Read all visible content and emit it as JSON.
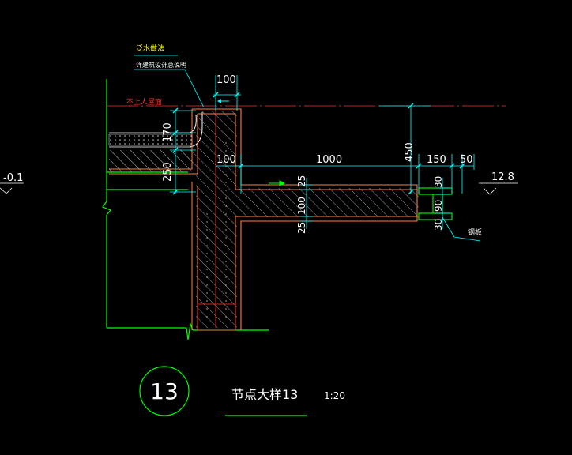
{
  "colors": {
    "background": "#000000",
    "outline": "#ff8040",
    "hatch": "#b0b0b0",
    "structure": "#00ff00",
    "dimension": "#00ffff",
    "dim_text": "#ffffff",
    "level_line": "#ff3030",
    "note_text": "#ffff00",
    "arrow": "#00ff00"
  },
  "notes": {
    "waterproof_method": "泛水做法",
    "see_spec": "详建筑设计总说明",
    "no_roof_access": "不上人屋面",
    "steel_plate": "钢板"
  },
  "levels": {
    "left": "-0.1",
    "right": "12.8"
  },
  "dimensions": {
    "top_width": "100",
    "curb_height": "170",
    "wall_drop": "250",
    "left_offset": "100",
    "cantilever": "1000",
    "gutter_depth": "450",
    "lip_width": "150",
    "lip_thickness": "50",
    "slab_upper": "25",
    "slab": "100",
    "slab_lower": "25",
    "plate_top": "30",
    "plate_mid": "90",
    "plate_bottom": "30"
  },
  "title": {
    "number": "13",
    "name": "节点大样13",
    "scale": "1:20"
  }
}
